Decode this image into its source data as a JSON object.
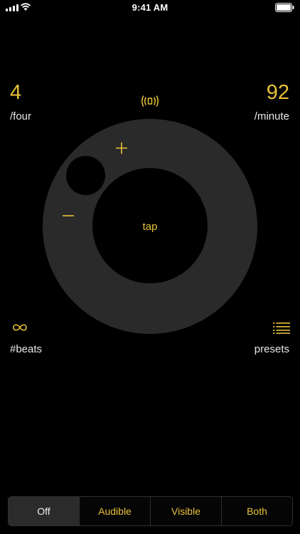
{
  "status_bar": {
    "time": "9:41 AM"
  },
  "beats": {
    "value": "4",
    "unit": "/four"
  },
  "tempo": {
    "value": "92",
    "unit": "/minute"
  },
  "dial": {
    "tap_label": "tap",
    "plus_label": "+",
    "minus_label": "−"
  },
  "bottom": {
    "beats_label": "#beats",
    "presets_label": "presets"
  },
  "mode_selector": {
    "options": [
      "Off",
      "Audible",
      "Visible",
      "Both"
    ],
    "selected": "Off"
  },
  "colors": {
    "accent": "#e8c23a",
    "background": "#000000",
    "dial": "#2a2a2a"
  },
  "icons": [
    "signal-icon",
    "wifi-icon",
    "battery-icon",
    "vibrate-icon",
    "plus-icon",
    "minus-icon",
    "infinity-icon",
    "list-icon"
  ]
}
